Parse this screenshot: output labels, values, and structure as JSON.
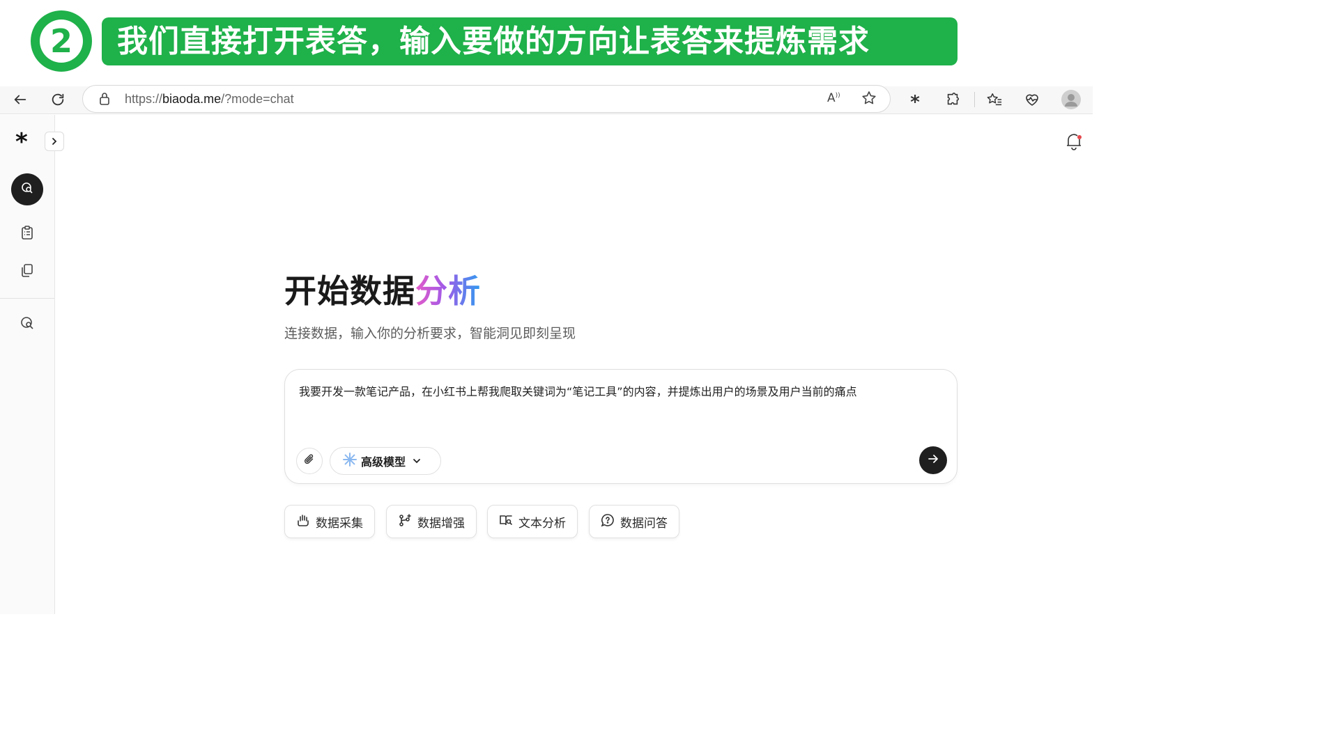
{
  "banner": {
    "step_number": "2",
    "caption": "我们直接打开表答，输入要做的方向让表答来提炼需求"
  },
  "browser": {
    "url_prefix": "https://",
    "url_domain": "biaoda.me",
    "url_path": "/?mode=chat",
    "icons": [
      "back-icon",
      "reload-icon",
      "lock-icon",
      "read-aloud-icon",
      "star-icon",
      "asterisk-extension-icon",
      "puzzle-icon",
      "favorites-icon",
      "heartbeat-icon",
      "profile-avatar"
    ]
  },
  "sidebar": {
    "logo": "*",
    "items": [
      {
        "icon": "chat-icon",
        "active": true
      },
      {
        "icon": "clipboard-icon",
        "active": false
      },
      {
        "icon": "copy-icon",
        "active": false
      },
      {
        "icon": "chat-history-icon",
        "active": false
      }
    ]
  },
  "main": {
    "title_plain": "开始数据",
    "title_gradient": "分析",
    "subtitle": "连接数据，输入你的分析要求，智能洞见即刻呈现",
    "input_value": "我要开发一款笔记产品，在小红书上帮我爬取关键词为“笔记工具”的内容，并提炼出用户的场景及用户当前的痛点",
    "model_label": "高级模型",
    "quick_actions": [
      {
        "label": "数据采集",
        "icon": "hand-collect-icon"
      },
      {
        "label": "数据增强",
        "icon": "branch-plus-icon"
      },
      {
        "label": "文本分析",
        "icon": "book-search-icon"
      },
      {
        "label": "数据问答",
        "icon": "chat-question-icon"
      }
    ]
  },
  "colors": {
    "brand_green": "#1fb14a",
    "dark": "#1f1f1f",
    "gradient_start": "#e45bc8",
    "gradient_end": "#2f9bf0"
  }
}
